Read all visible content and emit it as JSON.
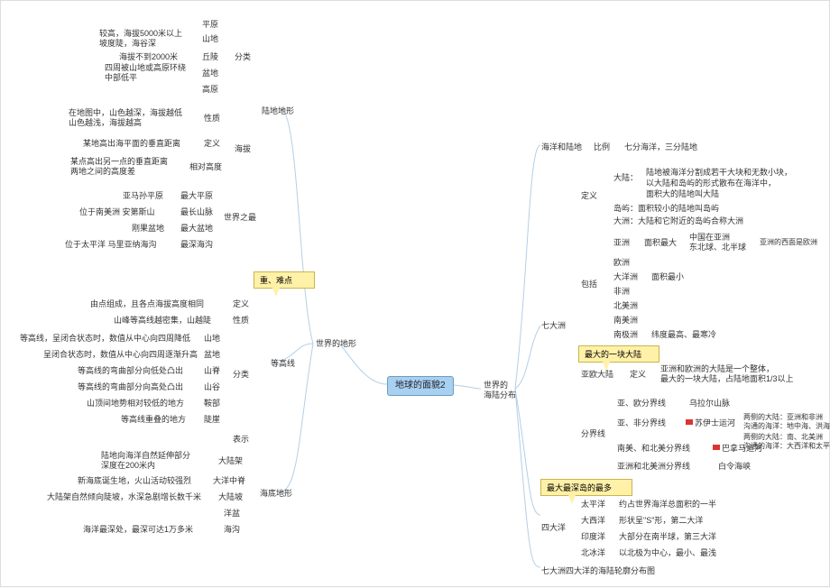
{
  "root": "地球的面貌2",
  "callouts": {
    "重难点": "重、难点",
    "最大一块大陆": "最大的一块大陆",
    "最大最深岛最多": "最大最深岛的最多"
  },
  "left": {
    "世界的地形": "世界的地形",
    "陆地地形": {
      "title": "陆地地形",
      "分类": {
        "title": "分类",
        "平原": "平原",
        "山地": {
          "label": "山地",
          "text": "较高，海拔5000米以上\n坡度陡，海谷深"
        },
        "丘陵": {
          "label": "丘陵",
          "text": "海拔不到2000米"
        },
        "盆地": {
          "label": "盆地",
          "text": "四周被山地或高原环绕\n中部低平"
        },
        "高原": "高原"
      },
      "海拔": {
        "title": "海拔",
        "性质": {
          "label": "性质",
          "text": "在地图中，山色越深，海拔越低\n山色越浅，海拔越高"
        },
        "定义": {
          "label": "定义",
          "text": "某地高出海平面的垂直距离"
        },
        "相对高度": {
          "label": "相对高度",
          "text": "某点高出另一点的垂直距离\n两地之间的高度差"
        }
      },
      "世界之最": {
        "title": "世界之最",
        "最大平原": {
          "label": "最大平原",
          "text": "亚马孙平原"
        },
        "最长山脉": {
          "label": "最长山脉",
          "text": "位于南美洲  安第斯山"
        },
        "最大盆地": {
          "label": "最大盆地",
          "text": "刚果盆地"
        },
        "最深海沟": {
          "label": "最深海沟",
          "text": "位于太平洋  马里亚纳海沟"
        }
      }
    },
    "等高线": {
      "title": "等高线",
      "定义": {
        "label": "定义",
        "text": "由点组成，且各点海拔高度相同"
      },
      "性质": {
        "label": "性质",
        "text": "山峰等高线越密集，山越陡"
      },
      "分类": {
        "label": "分类",
        "山地": "等高线，呈闭合状态时，数值从中心向四周降低",
        "盆地": "呈闭合状态时，数值从中心向四周逐渐升高",
        "山脊": "等高线的弯曲部分向低处凸出",
        "山谷": "等高线的弯曲部分向高处凸出",
        "鞍部": "山顶间地势相对较低的地方",
        "陡崖": "等高线重叠的地方"
      },
      "表示": "表示"
    },
    "海底地形": {
      "title": "海底地形",
      "大陆架": {
        "label": "大陆架",
        "text": "陆地向海洋自然延伸部分\n深度在200米内"
      },
      "大洋中脊": {
        "label": "大洋中脊",
        "text": "新海底诞生地，火山活动较强烈"
      },
      "大陆坡": {
        "label": "大陆坡",
        "text": "大陆架自然倾向陡坡，水深急剧增长数千米"
      },
      "洋盆": "洋盆",
      "海沟": {
        "label": "海沟",
        "text": "海洋最深处，最深可达1万多米"
      }
    }
  },
  "right": {
    "世界的海陆分布": "世界的\n海陆分布",
    "海洋和陆地": {
      "title": "海洋和陆地",
      "比例": {
        "label": "比例",
        "text": "七分海洋，三分陆地"
      }
    },
    "七大洲": {
      "title": "七大洲",
      "定义": {
        "label": "定义",
        "大陆": {
          "label": "大陆：",
          "t1": "陆地被海洋分割成若干大块和无数小块，",
          "t2": "以大陆和岛屿的形式散布在海洋中，",
          "t3": "面积大的陆地叫大陆"
        },
        "岛屿": "岛屿：面积较小的陆地叫岛屿",
        "大洲": "大洲：大陆和它附近的岛屿合称大洲"
      },
      "包括": {
        "label": "包括",
        "亚洲": {
          "label": "亚洲",
          "面积最大": "面积最大",
          "text": "中国在亚洲\n东北球、北半球",
          "extra": "亚洲的西面是欧洲"
        },
        "欧洲": "欧洲",
        "大洋洲": {
          "label": "大洋洲",
          "面积最小": "面积最小"
        },
        "非洲": "非洲",
        "北美洲": "北美洲",
        "南美洲": "南美洲",
        "南极洲": {
          "label": "南极洲",
          "text": "纬度最高、最寒冷"
        }
      },
      "亚欧大陆": {
        "label": "亚欧大陆",
        "定义": "定义",
        "text": "亚洲和欧洲的大陆是一个整体，\n最大的一块大陆，占陆地面积1/3以上"
      },
      "分界线": {
        "label": "分界线",
        "亚欧分界线": {
          "label": "亚、欧分界线",
          "text": "乌拉尔山脉"
        },
        "亚非分界线": {
          "label": "亚、非分界线",
          "text": "苏伊士运河",
          "extra": "两侧的大陆：亚洲和非洲\n沟通的海洋：地中海、洪海"
        },
        "南北美分界线": {
          "label": "南美、和北美分界线",
          "text": "巴拿马运河",
          "extra": "两侧的大陆：南、北美洲\n沟通的海洋：大西洋和太平洋"
        },
        "亚北美分界线": {
          "label": "亚洲和北美洲分界线",
          "text": "白令海峡"
        }
      }
    },
    "四大洋": {
      "title": "四大洋",
      "太平洋": {
        "label": "太平洋",
        "text": "约占世界海洋总面积的一半"
      },
      "大西洋": {
        "label": "大西洋",
        "text": "形状呈\"S\"形，第二大洋"
      },
      "印度洋": {
        "label": "印度洋",
        "text": "大部分在南半球，第三大洋"
      },
      "北冰洋": {
        "label": "北冰洋",
        "text": "以北极为中心，最小、最浅"
      }
    },
    "轮廓图": "七大洲四大洋的海陆轮廓分布图"
  }
}
